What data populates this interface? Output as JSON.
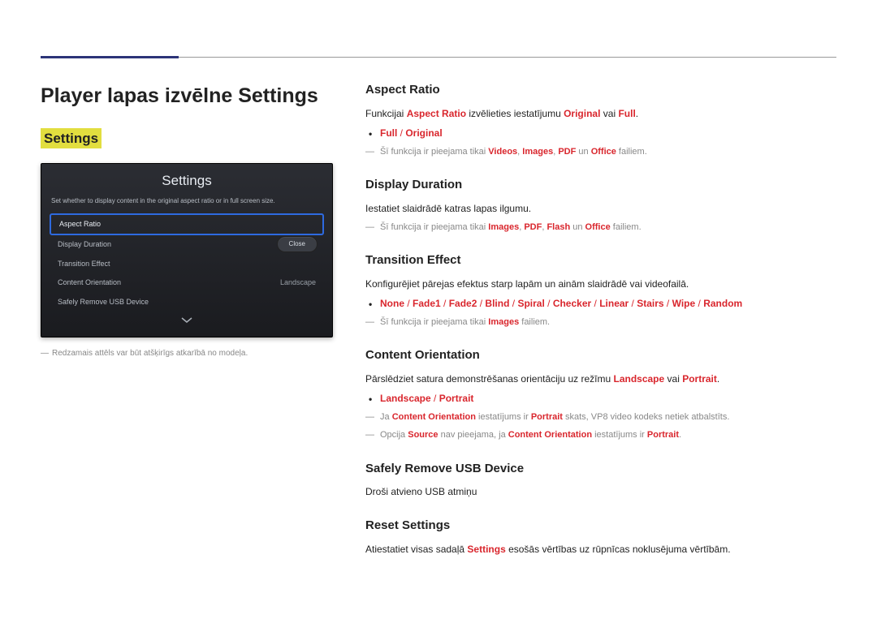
{
  "page_title": "Player lapas izvēlne Settings",
  "section_heading": "Settings",
  "settings_panel": {
    "title": "Settings",
    "description": "Set whether to display content in the original aspect ratio or in full screen size.",
    "items": [
      {
        "label": "Aspect Ratio",
        "value": "",
        "selected": true
      },
      {
        "label": "Display Duration",
        "value": ""
      },
      {
        "label": "Transition Effect",
        "value": ""
      },
      {
        "label": "Content Orientation",
        "value": "Landscape"
      },
      {
        "label": "Safely Remove USB Device",
        "value": ""
      }
    ],
    "close_label": "Close"
  },
  "image_note": "Redzamais attēls var būt atšķirīgs atkarībā no modeļa.",
  "sections": {
    "aspect_ratio": {
      "title": "Aspect Ratio",
      "desc_pre": "Funkcijai ",
      "desc_key": "Aspect Ratio",
      "desc_mid": " izvēlieties iestatījumu ",
      "opt1": "Original",
      "desc_or": " vai ",
      "opt2": "Full",
      "desc_end": ".",
      "bullet1_a": "Full",
      "bullet1_sep": " / ",
      "bullet1_b": "Original",
      "note_pre": "Šī funkcija ir pieejama tikai ",
      "note_k1": "Videos",
      "note_s": ", ",
      "note_k2": "Images",
      "note_k3": "PDF",
      "note_and": " un ",
      "note_k4": "Office",
      "note_end": " failiem."
    },
    "display_duration": {
      "title": "Display Duration",
      "desc": "Iestatiet slaidrādē katras lapas ilgumu.",
      "note_pre": "Šī funkcija ir pieejama tikai ",
      "note_k1": "Images",
      "note_s": ", ",
      "note_k2": "PDF",
      "note_k3": "Flash",
      "note_and": " un ",
      "note_k4": "Office",
      "note_end": " failiem."
    },
    "transition": {
      "title": "Transition Effect",
      "desc": "Konfigurējiet pārejas efektus starp lapām un ainām slaidrādē vai videofailā.",
      "effects": [
        "None",
        "Fade1",
        "Fade2",
        "Blind",
        "Spiral",
        "Checker",
        "Linear",
        "Stairs",
        "Wipe",
        "Random"
      ],
      "sep": " / ",
      "note_pre": "Šī funkcija ir pieejama tikai ",
      "note_k1": "Images",
      "note_end": " failiem."
    },
    "orientation": {
      "title": "Content Orientation",
      "desc_pre": "Pārslēdziet satura demonstrēšanas orientāciju uz režīmu ",
      "opt1": "Landscape",
      "desc_or": " vai ",
      "opt2": "Portrait",
      "desc_end": ".",
      "bullet_a": "Landscape",
      "bullet_sep": " / ",
      "bullet_b": "Portrait",
      "note1_pre": "Ja ",
      "note1_k1": "Content Orientation",
      "note1_mid": " iestatījums ir ",
      "note1_k2": "Portrait",
      "note1_end": " skats, VP8 video kodeks netiek atbalstīts.",
      "note2_pre": "Opcija ",
      "note2_k1": "Source",
      "note2_mid": " nav pieejama, ja ",
      "note2_k2": "Content Orientation",
      "note2_mid2": " iestatījums ir ",
      "note2_k3": "Portrait",
      "note2_end": "."
    },
    "safely_remove": {
      "title": "Safely Remove USB Device",
      "desc": "Droši atvieno USB atmiņu"
    },
    "reset": {
      "title": "Reset Settings",
      "desc_pre": "Atiestatiet visas sadaļā ",
      "key": "Settings",
      "desc_end": " esošās vērtības uz rūpnīcas noklusējuma vērtībām."
    }
  }
}
